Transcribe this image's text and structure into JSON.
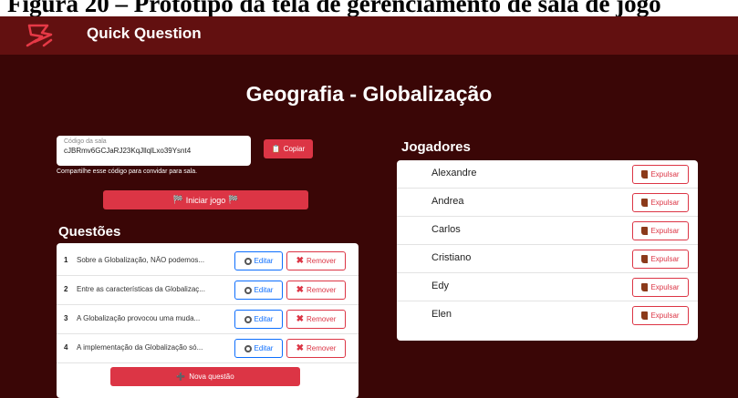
{
  "caption": "Figura 20 – Protótipo da tela de gerenciamento de sala de jogo",
  "navbar": {
    "brand": "Quick Question"
  },
  "room": {
    "title": "Geografia - Globalização",
    "code_label": "Código da sala",
    "code_value": "cJBRmv6GCJaRJ23KqJllqlLxo39Ysnt4",
    "copy_label": "Copiar",
    "share_text": "Compartilhe esse código para convidar para sala.",
    "start_label": "Iniciar jogo"
  },
  "questions": {
    "title": "Questões",
    "edit_label": "Editar",
    "remove_label": "Remover",
    "new_label": "Nova questão",
    "items": [
      {
        "num": "1",
        "text": "Sobre a Globalização, NÃO podemos..."
      },
      {
        "num": "2",
        "text": "Entre as características da Globalizaç..."
      },
      {
        "num": "3",
        "text": "A Globalização provocou uma muda..."
      },
      {
        "num": "4",
        "text": "A implementação da Globalização só..."
      }
    ]
  },
  "players": {
    "title": "Jogadores",
    "kick_label": "Expulsar",
    "items": [
      "Alexandre",
      "Andrea",
      "Carlos",
      "Cristiano",
      "Edy",
      "Elen"
    ]
  },
  "colors": {
    "navbar": "#621010",
    "background": "#3a0606",
    "accent": "#dc3545",
    "edit": "#0d6efd"
  }
}
